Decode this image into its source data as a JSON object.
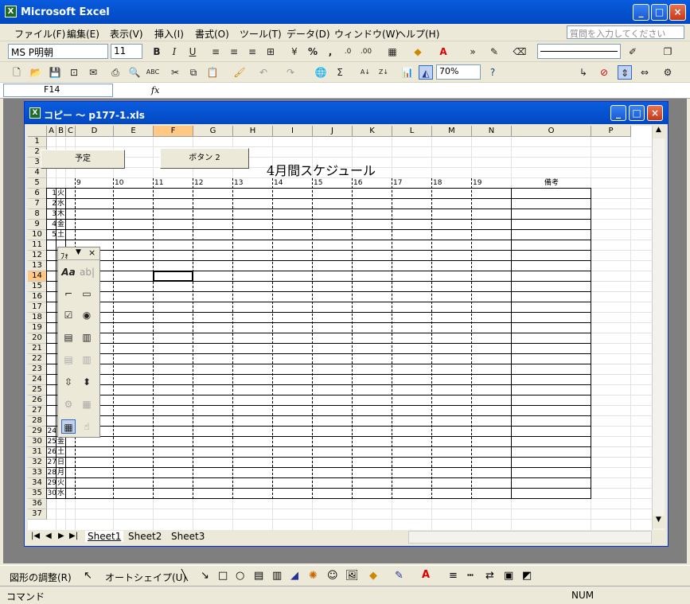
{
  "window": {
    "title": "Microsoft Excel",
    "minimize": "_",
    "maximize": "□",
    "close": "×"
  },
  "menu": {
    "items": [
      "ファイル(F)",
      "編集(E)",
      "表示(V)",
      "挿入(I)",
      "書式(O)",
      "ツール(T)",
      "データ(D)",
      "ウィンドウ(W)",
      "ヘルプ(H)"
    ],
    "help_placeholder": "質問を入力してください"
  },
  "format_toolbar": {
    "font": "MS P明朝",
    "size": "11",
    "bold": "B",
    "italic": "I",
    "underline": "U",
    "percent": "%",
    "comma": ","
  },
  "standard_toolbar": {
    "zoom": "70%",
    "sigma": "Σ"
  },
  "formula_bar": {
    "namebox": "F14",
    "fx": "fx"
  },
  "workbook": {
    "title": "コピー 〜 p177-1.xls"
  },
  "columns": [
    "A",
    "B",
    "C",
    "D",
    "E",
    "F",
    "G",
    "H",
    "I",
    "J",
    "K",
    "L",
    "M",
    "N",
    "O",
    "P"
  ],
  "rows": [
    "1",
    "2",
    "3",
    "4",
    "5",
    "6",
    "7",
    "8",
    "9",
    "10",
    "11",
    "12",
    "13",
    "14",
    "15",
    "16",
    "17",
    "18",
    "19",
    "20",
    "21",
    "22",
    "23",
    "24",
    "25",
    "26",
    "27",
    "28",
    "29",
    "30",
    "31",
    "32",
    "33",
    "34",
    "35",
    "36",
    "37"
  ],
  "sheet": {
    "buttons": [
      "予定",
      "ボタン 2"
    ],
    "heading": "4月間スケジュール",
    "hours": [
      "9",
      "10",
      "11",
      "12",
      "13",
      "14",
      "15",
      "16",
      "17",
      "18",
      "19"
    ],
    "remarks": "備考",
    "days_top": [
      [
        "1",
        "火"
      ],
      [
        "2",
        "水"
      ],
      [
        "3",
        "木"
      ],
      [
        "4",
        "金"
      ],
      [
        "5",
        "土"
      ]
    ],
    "days_bottom": [
      [
        "24",
        "木"
      ],
      [
        "25",
        "金"
      ],
      [
        "26",
        "土"
      ],
      [
        "27",
        "日"
      ],
      [
        "28",
        "月"
      ],
      [
        "29",
        "火"
      ],
      [
        "30",
        "水"
      ]
    ]
  },
  "forms_toolbar": {
    "title": "ﾌｫ"
  },
  "tabs": [
    "Sheet1",
    "Sheet2",
    "Sheet3"
  ],
  "drawing": {
    "adjust": "図形の調整(R)",
    "autoshape": "オートシェイプ(U)"
  },
  "status": {
    "left": "コマンド",
    "right": "NUM"
  }
}
